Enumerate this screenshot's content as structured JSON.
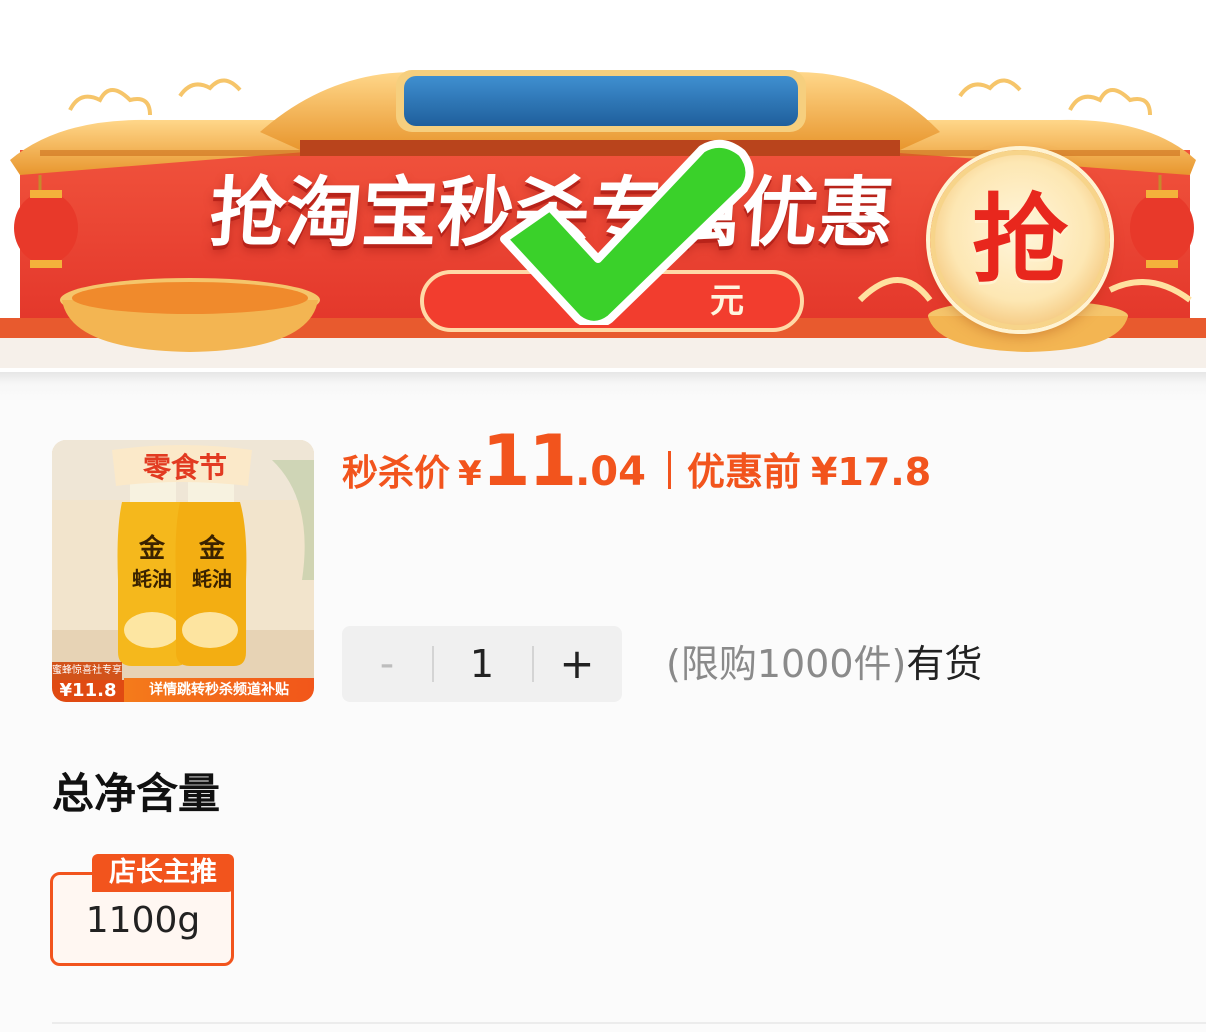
{
  "banner": {
    "title": "抢淘宝秒杀专属优惠",
    "pill_text": "元",
    "grab_badge": "抢",
    "check_overlay_icon": "checkmark-icon"
  },
  "product": {
    "thumbnail": {
      "festival_tag": "零食节",
      "bottle_label": "金 蚝油",
      "bottle_label_line1": "金",
      "bottle_label_line2": "蚝油",
      "exclusive_tag": "蜜蜂惊喜社专享",
      "was_price": "¥11.8",
      "subsidy_banner": "详情跳转秒杀频道补贴"
    },
    "price": {
      "flash_label": "秒杀价",
      "currency": "¥",
      "flash_integer": "11",
      "flash_decimal": ".04",
      "original_label": "优惠前",
      "original_price": "¥17.8"
    },
    "stepper": {
      "minus": "-",
      "quantity": "1",
      "plus": "+"
    },
    "stock": {
      "limit": "(限购1000件)",
      "status": "有货"
    }
  },
  "spec": {
    "title": "总净含量",
    "options": [
      {
        "value": "1100g",
        "badge": "店长主推",
        "selected": true
      }
    ]
  },
  "colors": {
    "accent": "#f2541d",
    "banner_red": "#e8342a",
    "check_green": "#3ad12a"
  }
}
